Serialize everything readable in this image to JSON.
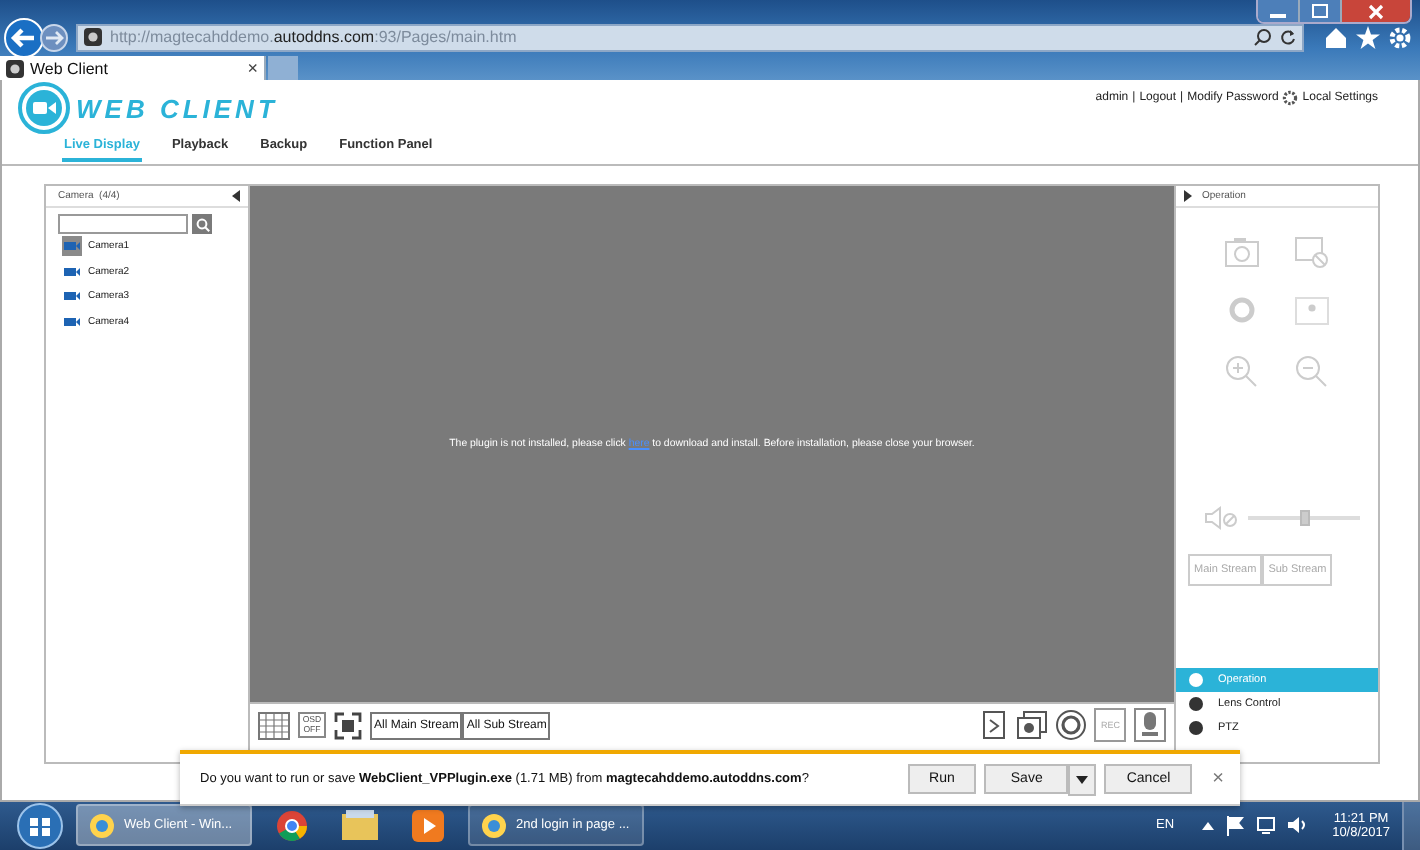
{
  "browser": {
    "url": "http://magtecahddemo.**autoddns.com**:93/Pages/main.htm",
    "tab": {
      "title": "Web Client",
      "close": "×"
    }
  },
  "header": {
    "logo": "WEB CLIENT",
    "user_links": [
      "admin",
      "Logout",
      "Modify Password"
    ],
    "separator": "|",
    "settings": "Local Settings"
  },
  "nav": [
    {
      "label": "Live Display",
      "selected": true
    },
    {
      "label": "Playback",
      "selected": false
    },
    {
      "label": "Backup",
      "selected": false
    },
    {
      "label": "Function Panel",
      "selected": false
    }
  ],
  "camera_panel": {
    "title": "Camera  (4/4)",
    "cameras": [
      {
        "name": "Camera1",
        "selected": true
      },
      {
        "name": "Camera2",
        "selected": false
      },
      {
        "name": "Camera3",
        "selected": false
      },
      {
        "name": "Camera4",
        "selected": false
      }
    ]
  },
  "video": {
    "message_before": "The plugin is not installed, please click",
    "link": "here",
    "message_after": "to download and install. Before installation, please close your browser."
  },
  "toolbar": {
    "osd": "OSD OFF",
    "buttons": [
      "All Main Stream",
      "All Sub Stream"
    ],
    "rec": "REC"
  },
  "operation_panel": {
    "title": "Operation",
    "volume": {
      "level": 0.5
    },
    "stream_buttons": [
      "Main Stream",
      "Sub Stream"
    ],
    "menu": [
      {
        "label": "Operation",
        "selected": true
      },
      {
        "label": "Lens Control",
        "selected": false
      },
      {
        "label": "PTZ",
        "selected": false
      }
    ]
  },
  "download_bar": {
    "message": "Do you want to run or save **WebClient_VPPlugin.exe** (1.71 MB) from **magtecahddemo.autoddns.com**?",
    "buttons": [
      "Run",
      "Save",
      "Cancel"
    ],
    "close": "×"
  },
  "taskbar": {
    "items": [
      {
        "kind": "window",
        "label": "Web Client - Win...",
        "selected": true
      },
      {
        "kind": "chrome",
        "selected": false
      },
      {
        "kind": "folder",
        "selected": false
      },
      {
        "kind": "media",
        "selected": false
      },
      {
        "kind": "window",
        "label": "2nd login in page ...",
        "selected": false
      }
    ],
    "language": "EN",
    "time": "11:21 PM",
    "date": "10/8/2017"
  }
}
